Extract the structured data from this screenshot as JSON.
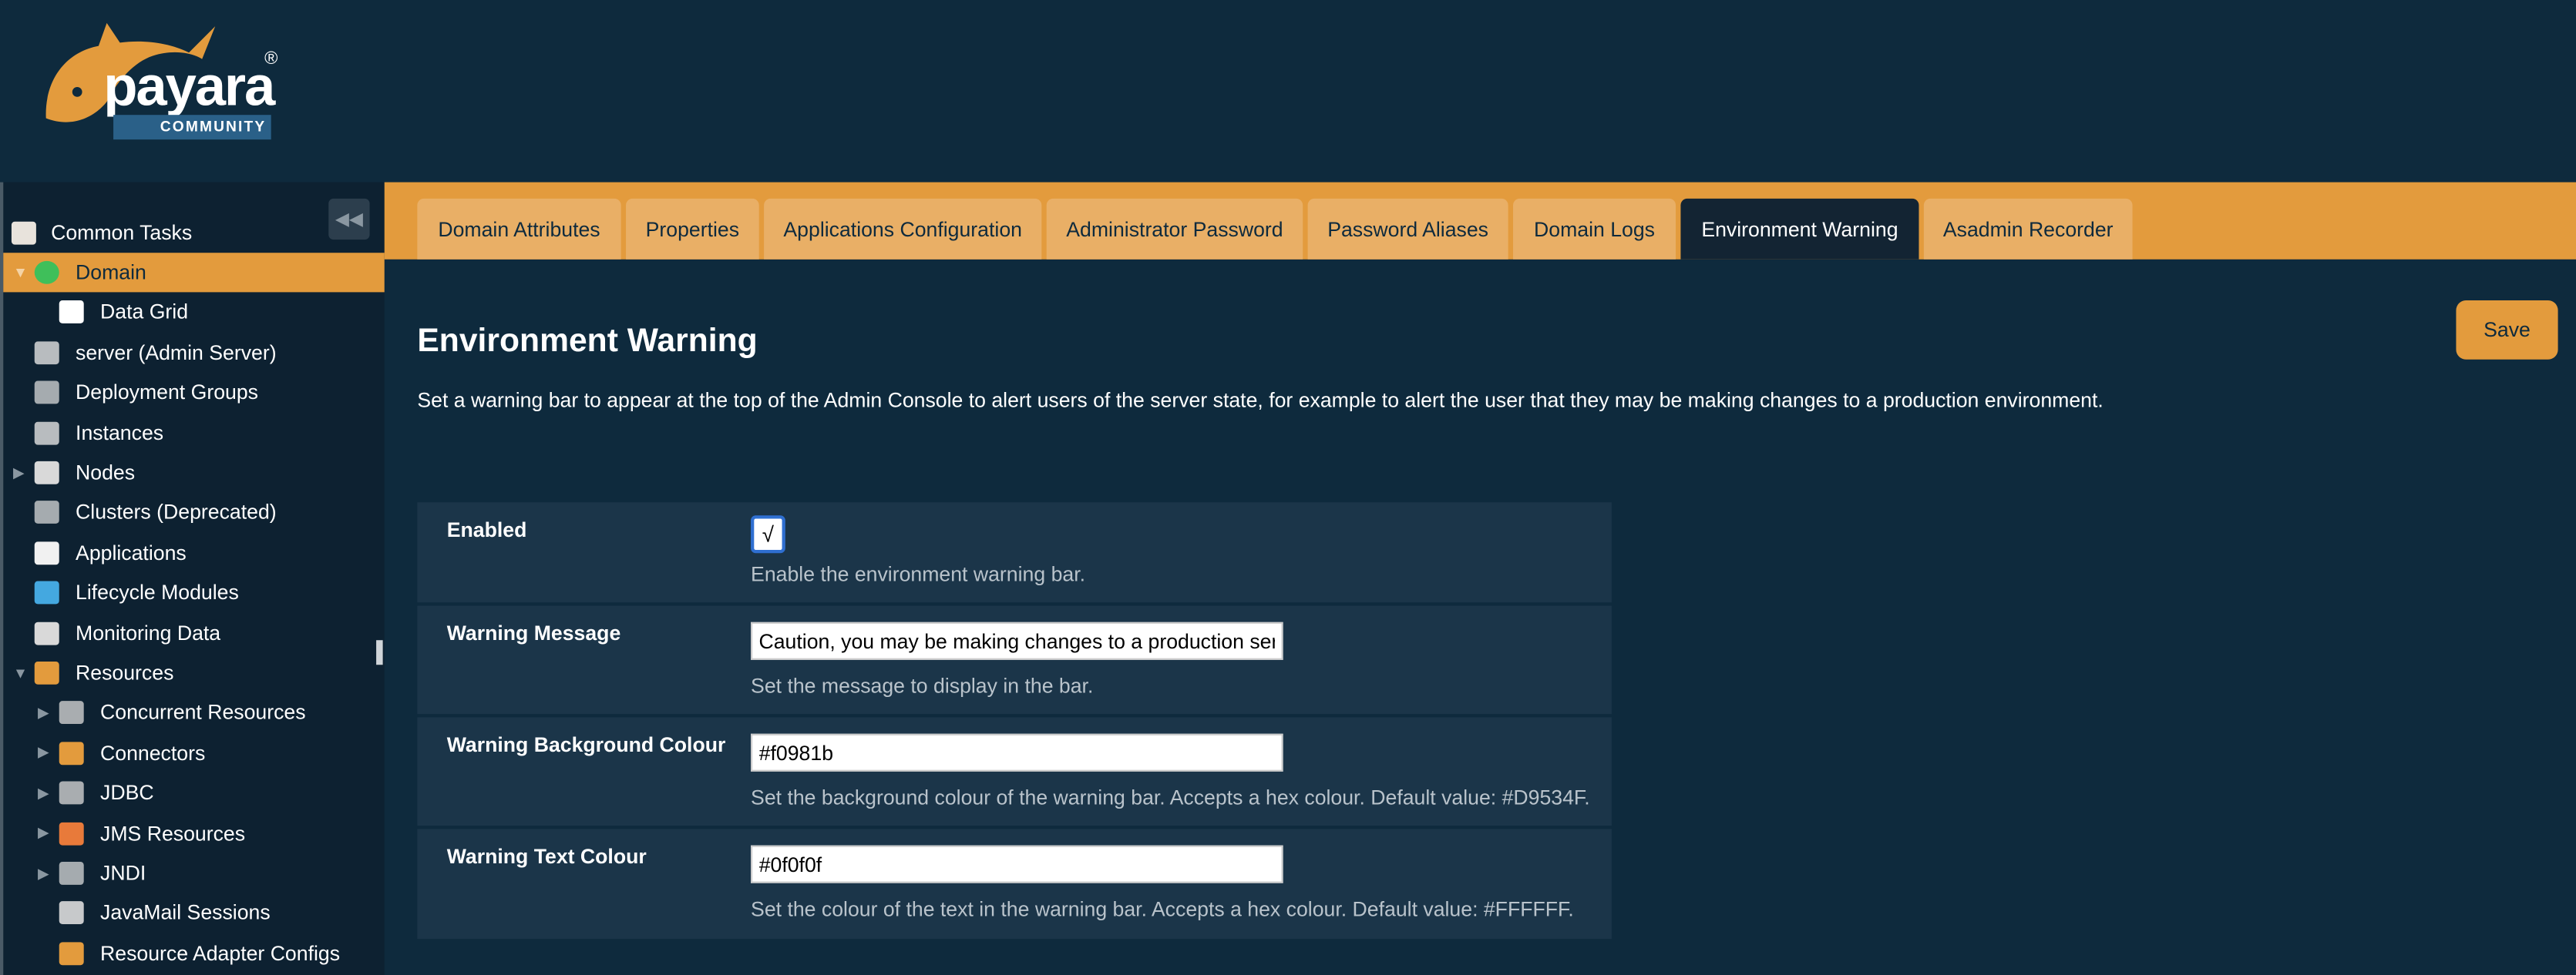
{
  "logo": {
    "brand": "payara",
    "registered": "®",
    "edition": "COMMUNITY",
    "brand_color": "#e39b3d"
  },
  "sidebar": {
    "collapse_icon": "double-chevron-left-icon",
    "items": [
      {
        "label": "Common Tasks",
        "icon": "calendar-icon",
        "level": 0
      },
      {
        "label": "Domain",
        "icon": "globe-icon",
        "level": 0,
        "expanded": true,
        "active": true
      },
      {
        "label": "Data Grid",
        "icon": "data-grid-icon",
        "level": 1
      },
      {
        "label": "server (Admin Server)",
        "icon": "server-icon",
        "level": 0
      },
      {
        "label": "Deployment Groups",
        "icon": "network-icon",
        "level": 0
      },
      {
        "label": "Instances",
        "icon": "server-icon",
        "level": 0
      },
      {
        "label": "Nodes",
        "icon": "monitor-icon",
        "level": 0,
        "expanded": false
      },
      {
        "label": "Clusters (Deprecated)",
        "icon": "network-icon",
        "level": 0
      },
      {
        "label": "Applications",
        "icon": "applications-icon",
        "level": 0
      },
      {
        "label": "Lifecycle Modules",
        "icon": "lifecycle-icon",
        "level": 0
      },
      {
        "label": "Monitoring Data",
        "icon": "monitor-icon",
        "level": 0
      },
      {
        "label": "Resources",
        "icon": "box-icon",
        "level": 0,
        "expanded": true
      },
      {
        "label": "Concurrent Resources",
        "icon": "database-icon",
        "level": 1,
        "expanded": false
      },
      {
        "label": "Connectors",
        "icon": "puzzle-icon",
        "level": 1,
        "expanded": false
      },
      {
        "label": "JDBC",
        "icon": "database-icon",
        "level": 1,
        "expanded": false
      },
      {
        "label": "JMS Resources",
        "icon": "exchange-arrows-icon",
        "level": 1,
        "expanded": false
      },
      {
        "label": "JNDI",
        "icon": "filter-icon",
        "level": 1,
        "expanded": false
      },
      {
        "label": "JavaMail Sessions",
        "icon": "envelope-icon",
        "level": 1
      },
      {
        "label": "Resource Adapter Configs",
        "icon": "puzzle-icon",
        "level": 1
      }
    ]
  },
  "tabs": [
    {
      "label": "Domain Attributes"
    },
    {
      "label": "Properties"
    },
    {
      "label": "Applications Configuration"
    },
    {
      "label": "Administrator Password"
    },
    {
      "label": "Password Aliases"
    },
    {
      "label": "Domain Logs"
    },
    {
      "label": "Environment Warning",
      "active": true
    },
    {
      "label": "Asadmin Recorder"
    }
  ],
  "main": {
    "title": "Environment Warning",
    "description": "Set a warning bar to appear at the top of the Admin Console to alert users of the server state, for example to alert the user that they may be making changes to a production environment.",
    "save_label": "Save",
    "fields": {
      "enabled": {
        "label": "Enabled",
        "checked": true,
        "check_glyph": "√",
        "help": "Enable the environment warning bar."
      },
      "message": {
        "label": "Warning Message",
        "value": "Caution, you may be making changes to a production server",
        "help": "Set the message to display in the bar."
      },
      "bg": {
        "label": "Warning Background Colour",
        "value": "#f0981b",
        "help": "Set the background colour of the warning bar. Accepts a hex colour. Default value: #D9534F."
      },
      "text": {
        "label": "Warning Text Colour",
        "value": "#0f0f0f",
        "help": "Set the colour of the text in the warning bar. Accepts a hex colour. Default value: #FFFFFF."
      }
    }
  },
  "colors": {
    "accent": "#e39b3d",
    "background": "#0e2a3d",
    "sidebar": "#0d2131",
    "panel": "#1b3549"
  }
}
